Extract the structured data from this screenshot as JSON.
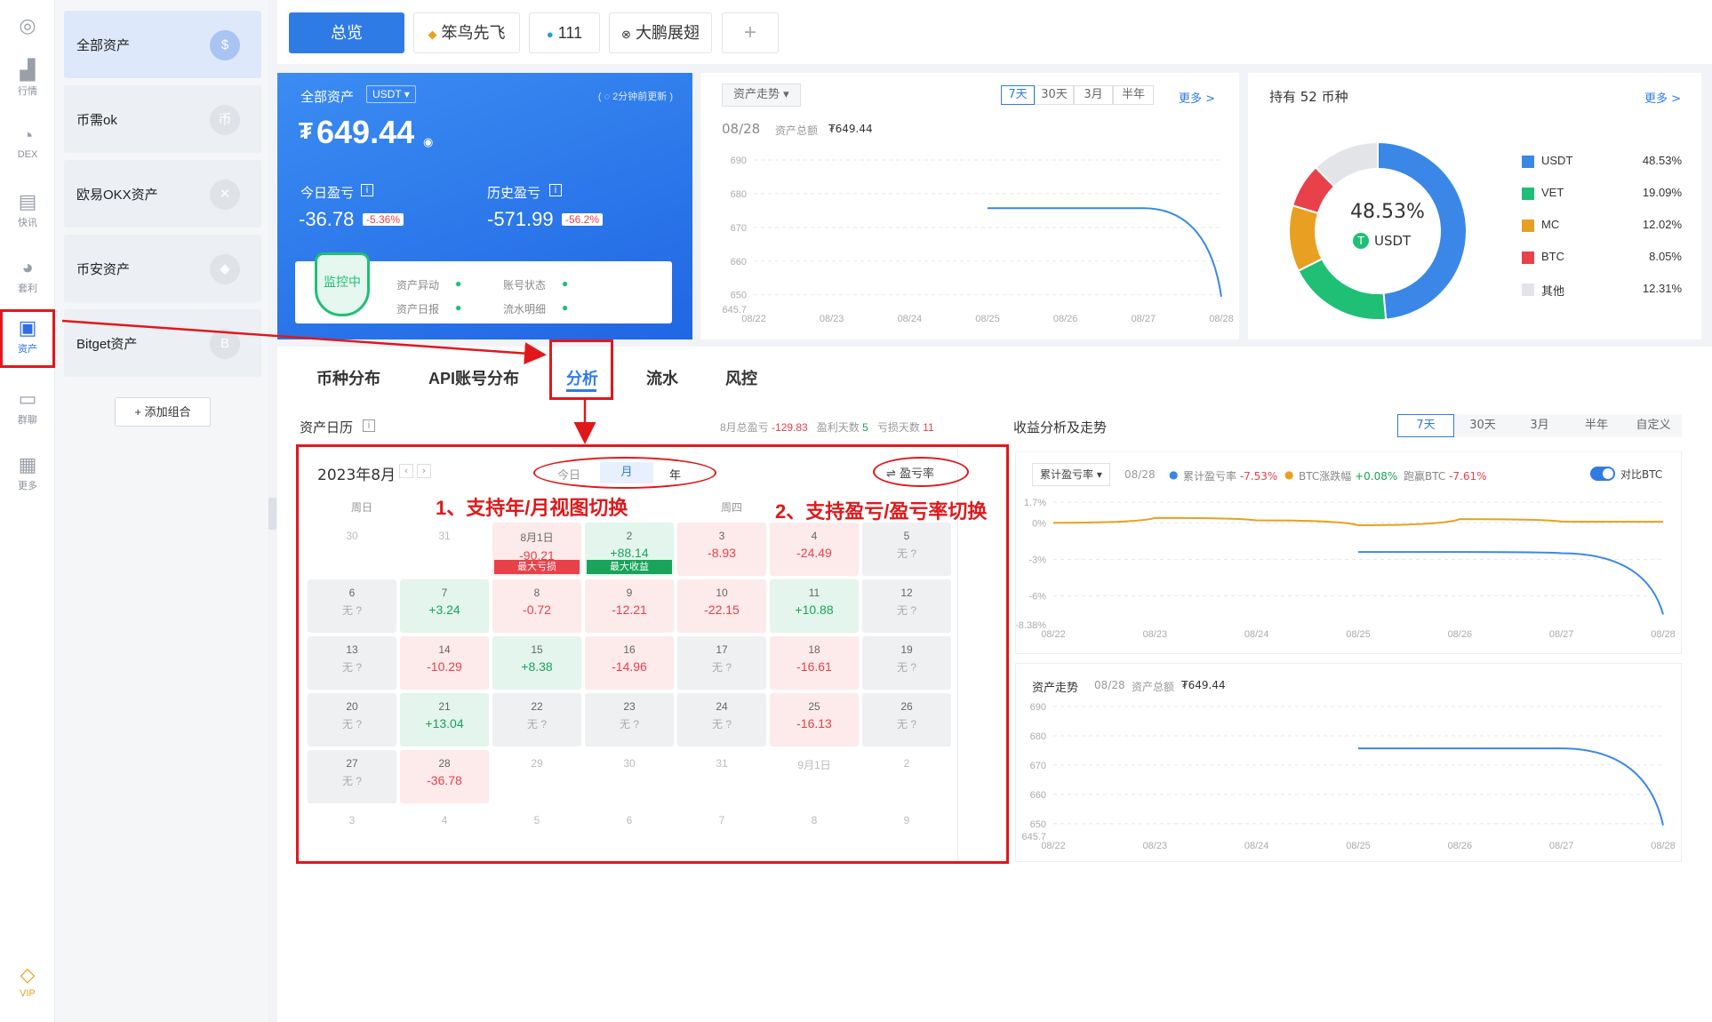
{
  "rail": {
    "items": [
      {
        "label": ""
      },
      {
        "label": "行情"
      },
      {
        "label": "DEX"
      },
      {
        "label": "快讯"
      },
      {
        "label": "套利"
      },
      {
        "label": "资产"
      },
      {
        "label": "群聊"
      },
      {
        "label": "更多"
      }
    ],
    "vip": "VIP"
  },
  "groups": {
    "items": [
      {
        "label": "全部资产",
        "icon": "$"
      },
      {
        "label": "币需ok",
        "icon": "币"
      },
      {
        "label": "欧易OKX资产",
        "icon": "✕"
      },
      {
        "label": "币安资产",
        "icon": "◆"
      },
      {
        "label": "Bitget资产",
        "icon": "B"
      }
    ],
    "add": "+ 添加组合"
  },
  "top_tabs": [
    "总览",
    "笨鸟先飞",
    "111",
    "大鹏展翅",
    "+"
  ],
  "summary": {
    "title": "全部资产",
    "currency": "USDT",
    "update": "( ◌ 2分钟前更新 )",
    "symbol": "₮",
    "total": "649.44",
    "today_label": "今日盈亏",
    "today_value": "-36.78",
    "today_pct": "-5.36%",
    "hist_label": "历史盈亏",
    "hist_value": "-571.99",
    "hist_pct": "-56.2%",
    "shield": "监控中",
    "checks": [
      "资产异动",
      "账号状态",
      "资产日报",
      "流水明细"
    ]
  },
  "trend": {
    "select": "资产走势",
    "ranges": [
      "7天",
      "30天",
      "3月",
      "半年"
    ],
    "more": "更多 >",
    "date": "08/28",
    "total_label": "资产总额",
    "total_value": "₮649.44"
  },
  "holdings": {
    "title": "持有 52 币种",
    "more": "更多 >",
    "center_pct": "48.53%",
    "center_coin": "USDT",
    "coin_icon": "T"
  },
  "chart_data": [
    {
      "type": "line",
      "x": [
        "08/22",
        "08/23",
        "08/24",
        "08/25",
        "08/26",
        "08/27",
        "08/28"
      ],
      "yticks": [
        "690",
        "680",
        "670",
        "660",
        "650",
        "645.7"
      ],
      "ylim": [
        645.7,
        690
      ],
      "series": [
        {
          "values": [
            null,
            null,
            null,
            675.7,
            675.7,
            675.7,
            649.44
          ]
        }
      ],
      "color": "#3a87e8"
    },
    {
      "type": "pie",
      "labels": [
        "USDT",
        "VET",
        "MC",
        "BTC",
        "其他"
      ],
      "values": [
        48.53,
        19.09,
        12.02,
        8.05,
        12.31
      ],
      "pct_labels": [
        "48.53%",
        "19.09%",
        "12.02%",
        "8.05%",
        "12.31%"
      ],
      "colors": [
        "#3a87e8",
        "#1fbf75",
        "#e8a023",
        "#e8414a",
        "#e2e4e8"
      ]
    },
    {
      "type": "line",
      "x": [
        "08/22",
        "08/23",
        "08/24",
        "08/25",
        "08/26",
        "08/27",
        "08/28"
      ],
      "yticks": [
        "1.7%",
        "0%",
        "-3%",
        "-6%",
        "-8.38%"
      ],
      "ylim": [
        -8.38,
        1.7
      ],
      "series": [
        {
          "name": "累计盈亏率",
          "values": [
            null,
            null,
            null,
            -2.4,
            -2.4,
            -2.5,
            -7.53
          ],
          "color": "#3a87e8"
        },
        {
          "name": "BTC涨跌幅",
          "values": [
            0,
            0.4,
            0.2,
            -0.2,
            0.3,
            0.1,
            0.08
          ],
          "color": "#e8a023"
        }
      ]
    },
    {
      "type": "line",
      "x": [
        "08/22",
        "08/23",
        "08/24",
        "08/25",
        "08/26",
        "08/27",
        "08/28"
      ],
      "yticks": [
        "690",
        "680",
        "670",
        "660",
        "650",
        "645.7"
      ],
      "ylim": [
        645.7,
        690
      ],
      "series": [
        {
          "values": [
            null,
            null,
            null,
            675.7,
            675.7,
            675.7,
            649.44
          ]
        }
      ],
      "color": "#3a87e8"
    }
  ],
  "analysis": {
    "tabs": [
      "币种分布",
      "API账号分布",
      "分析",
      "流水",
      "风控"
    ],
    "cal_title": "资产日历",
    "month_total_label": "8月总盈亏",
    "month_total": "-129.83",
    "win_label": "盈利天数",
    "win": "5",
    "lose_label": "亏损天数",
    "lose": "11",
    "cal_month": "2023年8月",
    "views": [
      "今日",
      "月",
      "年"
    ],
    "toggle": "⇌ 盈亏率",
    "weekdays": [
      "周日",
      "",
      "",
      "",
      "周四",
      "",
      ""
    ],
    "cells": [
      {
        "d": "30",
        "v": "",
        "t": "out"
      },
      {
        "d": "31",
        "v": "",
        "t": "out"
      },
      {
        "d": "8月1日",
        "v": "-90.21",
        "t": "neg",
        "tag": "最大亏损"
      },
      {
        "d": "2",
        "v": "+88.14",
        "t": "pos",
        "tag": "最大收益"
      },
      {
        "d": "3",
        "v": "-8.93",
        "t": "neg"
      },
      {
        "d": "4",
        "v": "-24.49",
        "t": "neg"
      },
      {
        "d": "5",
        "v": "无 ?",
        "t": "none"
      },
      {
        "d": "6",
        "v": "无 ?",
        "t": "none"
      },
      {
        "d": "7",
        "v": "+3.24",
        "t": "pos"
      },
      {
        "d": "8",
        "v": "-0.72",
        "t": "neg"
      },
      {
        "d": "9",
        "v": "-12.21",
        "t": "neg"
      },
      {
        "d": "10",
        "v": "-22.15",
        "t": "neg"
      },
      {
        "d": "11",
        "v": "+10.88",
        "t": "pos"
      },
      {
        "d": "12",
        "v": "无 ?",
        "t": "none"
      },
      {
        "d": "13",
        "v": "无 ?",
        "t": "none"
      },
      {
        "d": "14",
        "v": "-10.29",
        "t": "neg"
      },
      {
        "d": "15",
        "v": "+8.38",
        "t": "pos"
      },
      {
        "d": "16",
        "v": "-14.96",
        "t": "neg"
      },
      {
        "d": "17",
        "v": "无 ?",
        "t": "none"
      },
      {
        "d": "18",
        "v": "-16.61",
        "t": "neg"
      },
      {
        "d": "19",
        "v": "无 ?",
        "t": "none"
      },
      {
        "d": "20",
        "v": "无 ?",
        "t": "none"
      },
      {
        "d": "21",
        "v": "+13.04",
        "t": "pos"
      },
      {
        "d": "22",
        "v": "无 ?",
        "t": "none"
      },
      {
        "d": "23",
        "v": "无 ?",
        "t": "none"
      },
      {
        "d": "24",
        "v": "无 ?",
        "t": "none"
      },
      {
        "d": "25",
        "v": "-16.13",
        "t": "neg"
      },
      {
        "d": "26",
        "v": "无 ?",
        "t": "none"
      },
      {
        "d": "27",
        "v": "无 ?",
        "t": "none"
      },
      {
        "d": "28",
        "v": "-36.78",
        "t": "neg"
      },
      {
        "d": "29",
        "v": "",
        "t": "out"
      },
      {
        "d": "30",
        "v": "",
        "t": "out"
      },
      {
        "d": "31",
        "v": "",
        "t": "out"
      },
      {
        "d": "9月1日",
        "v": "",
        "t": "out"
      },
      {
        "d": "2",
        "v": "",
        "t": "out"
      },
      {
        "d": "3",
        "v": "",
        "t": "out"
      },
      {
        "d": "4",
        "v": "",
        "t": "out"
      },
      {
        "d": "5",
        "v": "",
        "t": "out"
      },
      {
        "d": "6",
        "v": "",
        "t": "out"
      },
      {
        "d": "7",
        "v": "",
        "t": "out"
      },
      {
        "d": "8",
        "v": "",
        "t": "out"
      },
      {
        "d": "9",
        "v": "",
        "t": "out"
      }
    ],
    "profit_title": "收益分析及走势",
    "profit_ranges": [
      "7天",
      "30天",
      "3月",
      "半年",
      "自定义"
    ],
    "profit_select": "累计盈亏率",
    "profit_date": "08/28",
    "legend1_label": "累计盈亏率",
    "legend1_value": "-7.53%",
    "legend2_label": "BTC涨跌幅",
    "legend2_value": "+0.08%",
    "beat_label": "跑赢BTC",
    "beat_value": "-7.61%",
    "compare": "对比BTC",
    "trend2_title": "资产走势",
    "trend2_date": "08/28",
    "trend2_total_label": "资产总额",
    "trend2_total": "₮649.44"
  },
  "annotations": {
    "a1": "1、支持年/月视图切换",
    "a2": "2、支持盈亏/盈亏率切换"
  }
}
